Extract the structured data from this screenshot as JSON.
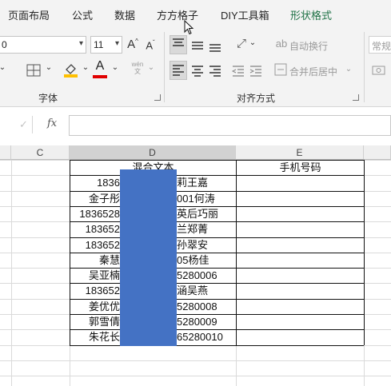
{
  "tabs": [
    {
      "label": "页面布局"
    },
    {
      "label": "公式"
    },
    {
      "label": "数据"
    },
    {
      "label": "方方格子"
    },
    {
      "label": "DIY工具箱"
    },
    {
      "label": "形状格式"
    }
  ],
  "ribbon": {
    "font_name_value": "0",
    "font_size_value": "11",
    "grow_font_label": "A",
    "shrink_font_label": "A",
    "font_color_label": "A",
    "phonetic_label": "wén",
    "auto_wrap_label": "自动换行",
    "merge_center_label": "合并后居中",
    "number_format_value": "常规",
    "font_group_label": "字体",
    "align_group_label": "对齐方式"
  },
  "formula_bar": {
    "fx_label": "fx",
    "cancel_label": "✓",
    "value": ""
  },
  "columns": [
    {
      "label": "C"
    },
    {
      "label": "D"
    },
    {
      "label": "E"
    }
  ],
  "table": {
    "header_d": "混合文本",
    "header_e": "手机号码",
    "rows": [
      {
        "left": "1836",
        "right": "莉王嘉"
      },
      {
        "left": "金子彤",
        "right": "001何涛"
      },
      {
        "left": "1836528",
        "right": "英后巧丽"
      },
      {
        "left": "183652",
        "right": "兰郑菁"
      },
      {
        "left": "183652",
        "right": "孙翠安"
      },
      {
        "left": "秦慧",
        "right": "05杨佳"
      },
      {
        "left": "吴亚楠",
        "right": "5280006"
      },
      {
        "left": "183652",
        "right": "涵吴燕"
      },
      {
        "left": "姜优优",
        "right": "5280008"
      },
      {
        "left": "郭雪倩",
        "right": "5280009"
      },
      {
        "left": "朱花长",
        "right": "65280010"
      }
    ]
  },
  "colors": {
    "accent": "#1e7145",
    "shape_fill": "#4472c4",
    "ribbon_bg": "#f3f3f3",
    "font_color_bar": "#e00000",
    "fill_color_bar": "#ffc000"
  }
}
